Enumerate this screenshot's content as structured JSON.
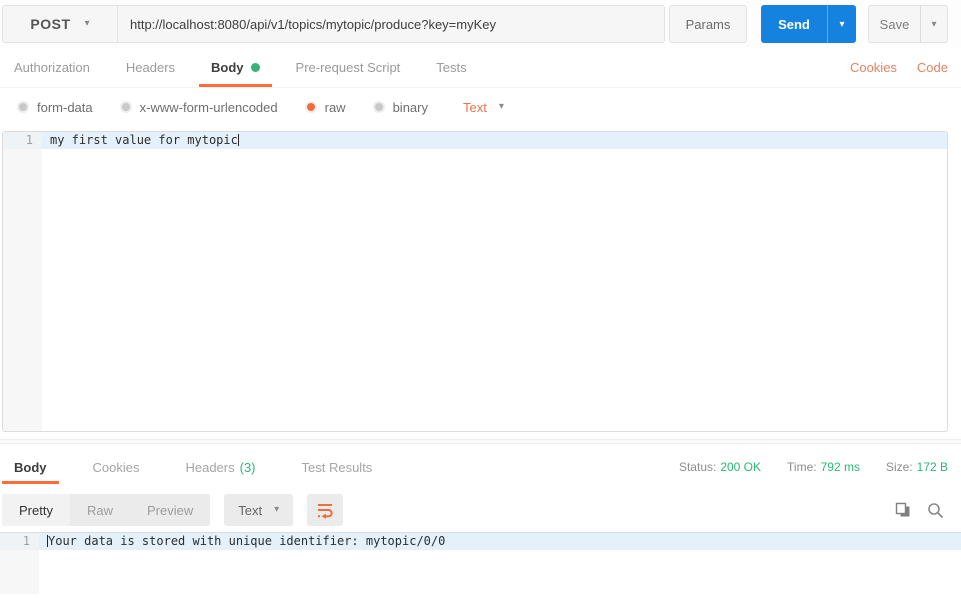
{
  "ui": {
    "caret_down": "▾"
  },
  "colors": {
    "accent_orange": "#ff6c37",
    "link_orange": "#e8815f",
    "send_blue": "#1682e0",
    "status_green": "#2cb874",
    "line_highlight": "#e4f1fb"
  },
  "request_bar": {
    "method": "POST",
    "url": "http://localhost:8080/api/v1/topics/mytopic/produce?key=myKey",
    "params_label": "Params",
    "send_label": "Send",
    "save_label": "Save"
  },
  "request_tabs": {
    "items": [
      {
        "label": "Authorization"
      },
      {
        "label": "Headers"
      },
      {
        "label": "Body",
        "active": true,
        "has_green_dot": true
      },
      {
        "label": "Pre-request Script"
      },
      {
        "label": "Tests"
      }
    ],
    "cookies_link": "Cookies",
    "code_link": "Code"
  },
  "body_type_bar": {
    "options": [
      {
        "label": "form-data",
        "selected": false
      },
      {
        "label": "x-www-form-urlencoded",
        "selected": false
      },
      {
        "label": "raw",
        "selected": true
      },
      {
        "label": "binary",
        "selected": false
      }
    ],
    "format_label": "Text"
  },
  "request_editor": {
    "line_number": "1",
    "content": "my first value for mytopic"
  },
  "response_meta": {
    "tabs": [
      {
        "label": "Body",
        "active": true
      },
      {
        "label": "Cookies"
      },
      {
        "label": "Headers",
        "count": "(3)"
      },
      {
        "label": "Test Results"
      }
    ],
    "status_label": "Status:",
    "status_value": "200 OK",
    "time_label": "Time:",
    "time_value": "792 ms",
    "size_label": "Size:",
    "size_value": "172 B"
  },
  "response_toolbar": {
    "view_modes": [
      "Pretty",
      "Raw",
      "Preview"
    ],
    "active_view": "Pretty",
    "format_label": "Text"
  },
  "response_editor": {
    "line_number": "1",
    "content": "Your data is stored with unique identifier: mytopic/0/0"
  }
}
